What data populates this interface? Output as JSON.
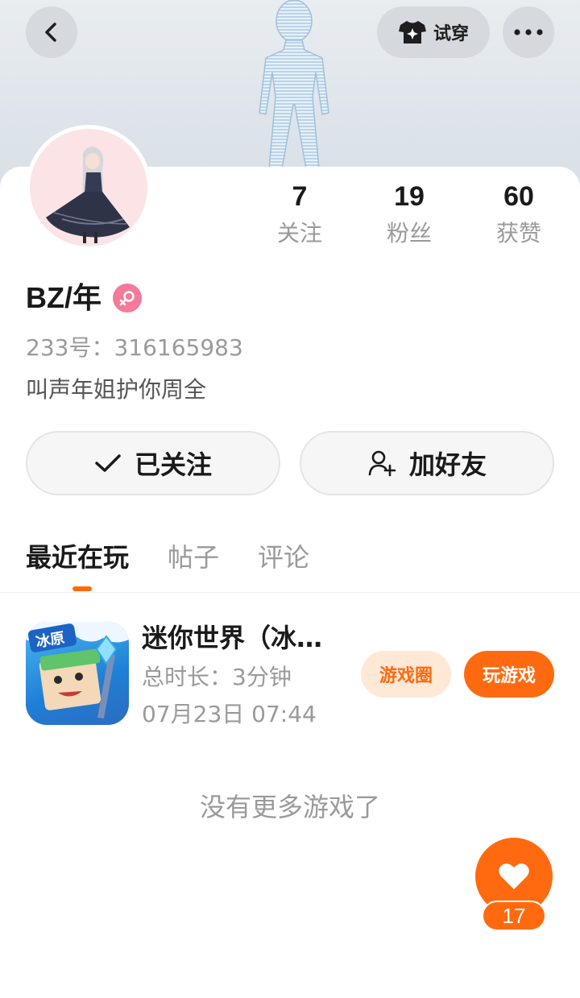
{
  "header": {
    "tryon_label": "试穿"
  },
  "stats": [
    {
      "value": "7",
      "label": "关注"
    },
    {
      "value": "19",
      "label": "粉丝"
    },
    {
      "value": "60",
      "label": "获赞"
    }
  ],
  "profile": {
    "username": "BZ/年",
    "gender": "female",
    "uid_text": "233号：316165983",
    "bio": "叫声年姐护你周全"
  },
  "actions": {
    "followed_label": "已关注",
    "add_friend_label": "加好友"
  },
  "tabs": [
    {
      "label": "最近在玩",
      "active": true
    },
    {
      "label": "帖子",
      "active": false
    },
    {
      "label": "评论",
      "active": false
    }
  ],
  "games": [
    {
      "title": "迷你世界（冰原版）",
      "icon_badge": "冰原",
      "duration": "总时长：3分钟",
      "last_played": "07月23日 07:44",
      "circle_label": "游戏圈",
      "play_label": "玩游戏"
    }
  ],
  "empty_hint": "没有更多游戏了",
  "like": {
    "count": "17"
  },
  "colors": {
    "accent": "#ff6a10",
    "accent_light": "#ffe8d6",
    "gender_female": "#f47a9a"
  }
}
